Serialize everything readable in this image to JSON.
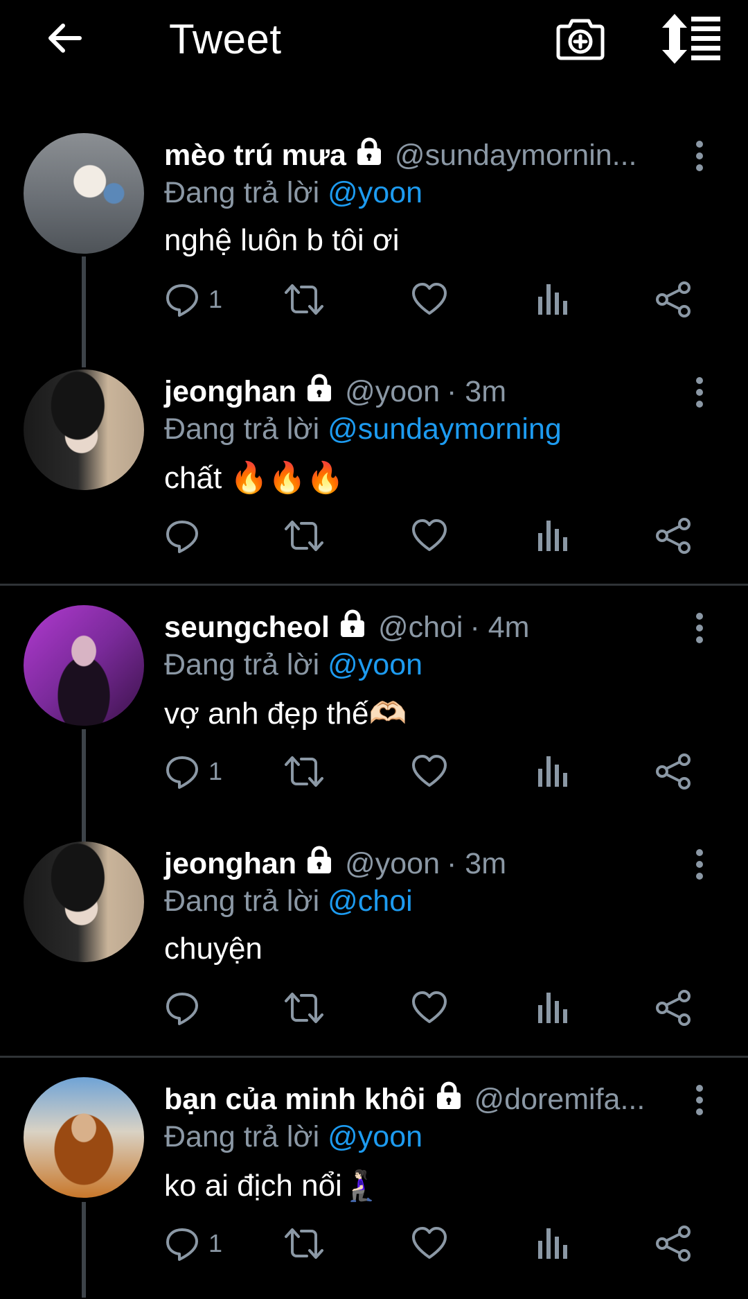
{
  "header": {
    "title": "Tweet"
  },
  "replying_label": "Đang trả lời",
  "tweets": [
    {
      "name": "mèo trú mưa",
      "handle": "@sundaymornin...",
      "time": "",
      "reply_to": "@yoon",
      "text": "nghệ luôn b tôi ơi",
      "reply_count": "1"
    },
    {
      "name": "jeonghan",
      "handle": "@yoon",
      "time": "· 3m",
      "reply_to": "@sundaymorning",
      "text": "chất 🔥🔥🔥",
      "reply_count": ""
    },
    {
      "name": "seungcheol",
      "handle": "@choi",
      "time": "· 4m",
      "reply_to": "@yoon",
      "text": "vợ anh đẹp thế🫶🏻",
      "reply_count": "1"
    },
    {
      "name": "jeonghan",
      "handle": "@yoon",
      "time": "· 3m",
      "reply_to": "@choi",
      "text": "chuyện",
      "reply_count": ""
    },
    {
      "name": "bạn của minh khôi",
      "handle": "@doremifa...",
      "time": "",
      "reply_to": "@yoon",
      "text": "ko ai địch nổi🧎🏻‍♀️",
      "reply_count": "1"
    }
  ],
  "colors": {
    "background": "#000000",
    "secondary_text": "#8b98a5",
    "mention": "#1d9bf0"
  }
}
